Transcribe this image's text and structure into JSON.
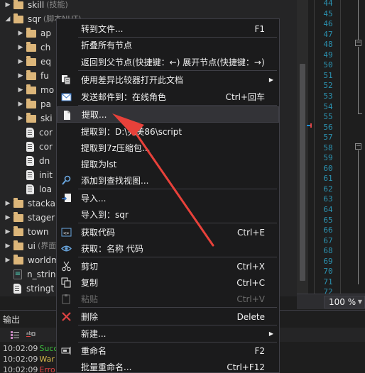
{
  "tree": {
    "items": [
      {
        "label": "skill",
        "sub": "(技能)",
        "kind": "folder",
        "expanded": false
      },
      {
        "label": "sqr",
        "sub": "(脚本NUT)",
        "kind": "folder",
        "expanded": true
      },
      {
        "label": "ap",
        "kind": "folder",
        "expanded": false
      },
      {
        "label": "ch",
        "kind": "folder",
        "expanded": false
      },
      {
        "label": "eq",
        "kind": "folder",
        "expanded": false
      },
      {
        "label": "fu",
        "kind": "folder",
        "expanded": false
      },
      {
        "label": "mo",
        "kind": "folder",
        "expanded": false
      },
      {
        "label": "pa",
        "kind": "folder",
        "expanded": false
      },
      {
        "label": "ski",
        "kind": "folder",
        "expanded": false
      },
      {
        "label": "cor",
        "kind": "script"
      },
      {
        "label": "cor",
        "kind": "script"
      },
      {
        "label": "dn",
        "kind": "script"
      },
      {
        "label": "init",
        "kind": "script"
      },
      {
        "label": "loa",
        "kind": "script"
      },
      {
        "label": "stacka",
        "kind": "folder",
        "expanded": false
      },
      {
        "label": "stager",
        "kind": "folder",
        "expanded": false
      },
      {
        "label": "town",
        "kind": "folder",
        "expanded": false
      },
      {
        "label": "ui",
        "sub": "(界面",
        "kind": "folder",
        "expanded": false
      },
      {
        "label": "worldm",
        "kind": "folder",
        "expanded": false
      },
      {
        "label": "n_strin",
        "kind": "stringtable"
      },
      {
        "label": "stringt",
        "kind": "script"
      }
    ]
  },
  "line_numbers": [
    "44",
    "45",
    "46",
    "47",
    "48",
    "49",
    "50",
    "51",
    "52",
    "53",
    "54",
    "55",
    "56",
    "57",
    "58",
    "59",
    "60",
    "61",
    "62",
    "63",
    "64",
    "65",
    "66",
    "67",
    "68",
    "69",
    "70",
    "71",
    "72"
  ],
  "zoom": {
    "value": "100 %"
  },
  "output": {
    "title": "输出",
    "lines": [
      {
        "time": "10:02:09",
        "text": "Succ",
        "color": "#3fbf3f"
      },
      {
        "time": "10:02:09",
        "text": "War",
        "color": "#d7ba4a"
      },
      {
        "time": "10:02:09",
        "text": "Erro",
        "color": "#e04343"
      }
    ]
  },
  "context_menu": {
    "items": [
      {
        "id": "goto-file",
        "label": "转到文件...",
        "shortcut": "F1",
        "icon": "",
        "submenu": false,
        "disabled": false
      },
      {
        "id": "sep1",
        "separator": true
      },
      {
        "id": "collapse-all",
        "label": "折叠所有节点",
        "shortcut": "",
        "icon": "",
        "submenu": false,
        "disabled": false
      },
      {
        "id": "back-parent",
        "label": "返回到父节点(快捷键：←) 展开节点(快捷键：→)",
        "shortcut": "",
        "icon": "",
        "submenu": false,
        "disabled": false
      },
      {
        "id": "sep2",
        "separator": true
      },
      {
        "id": "diff-open",
        "label": "使用差异比较器打开此文档",
        "shortcut": "",
        "icon": "diff-icon",
        "submenu": true,
        "disabled": false
      },
      {
        "id": "send-mail",
        "label": "发送邮件到：在线角色",
        "shortcut": "Ctrl+回车",
        "icon": "mail-icon",
        "submenu": false,
        "disabled": false
      },
      {
        "id": "sep3",
        "separator": true
      },
      {
        "id": "extract",
        "label": "提取...",
        "shortcut": "",
        "icon": "extract-icon",
        "submenu": false,
        "disabled": false,
        "highlighted": true
      },
      {
        "id": "extract-to",
        "label": "提取到：D:\\完美86\\script",
        "shortcut": "",
        "icon": "",
        "submenu": false,
        "disabled": false
      },
      {
        "id": "extract-7z",
        "label": "提取到7z压缩包...",
        "shortcut": "",
        "icon": "",
        "submenu": false,
        "disabled": false
      },
      {
        "id": "extract-lst",
        "label": "提取为lst",
        "shortcut": "",
        "icon": "",
        "submenu": false,
        "disabled": false
      },
      {
        "id": "add-view",
        "label": "添加到查找视图...",
        "shortcut": "",
        "icon": "find-view-icon",
        "submenu": false,
        "disabled": false
      },
      {
        "id": "sep4",
        "separator": true
      },
      {
        "id": "import",
        "label": "导入...",
        "shortcut": "",
        "icon": "import-icon",
        "submenu": false,
        "disabled": false
      },
      {
        "id": "import-to",
        "label": "导入到：sqr",
        "shortcut": "",
        "icon": "",
        "submenu": false,
        "disabled": false
      },
      {
        "id": "sep5",
        "separator": true
      },
      {
        "id": "get-code",
        "label": "获取代码",
        "shortcut": "Ctrl+E",
        "icon": "code-icon",
        "submenu": false,
        "disabled": false
      },
      {
        "id": "get-name-code",
        "label": "获取：名称 代码",
        "shortcut": "",
        "icon": "eye-icon",
        "submenu": false,
        "disabled": false
      },
      {
        "id": "sep6",
        "separator": true
      },
      {
        "id": "cut",
        "label": "剪切",
        "shortcut": "Ctrl+X",
        "icon": "cut-icon",
        "submenu": false,
        "disabled": false
      },
      {
        "id": "copy",
        "label": "复制",
        "shortcut": "Ctrl+C",
        "icon": "copy-icon",
        "submenu": false,
        "disabled": false
      },
      {
        "id": "paste",
        "label": "粘贴",
        "shortcut": "Ctrl+V",
        "icon": "paste-icon",
        "submenu": false,
        "disabled": true
      },
      {
        "id": "sep7",
        "separator": true
      },
      {
        "id": "delete",
        "label": "删除",
        "shortcut": "Delete",
        "icon": "delete-icon",
        "submenu": false,
        "disabled": false
      },
      {
        "id": "sep8",
        "separator": true
      },
      {
        "id": "new",
        "label": "新建...",
        "shortcut": "",
        "icon": "",
        "submenu": true,
        "disabled": false
      },
      {
        "id": "sep9",
        "separator": true
      },
      {
        "id": "rename",
        "label": "重命名",
        "shortcut": "F2",
        "icon": "rename-icon",
        "submenu": false,
        "disabled": false
      },
      {
        "id": "batch-rename",
        "label": "批量重命名...",
        "shortcut": "Ctrl+F12",
        "icon": "",
        "submenu": false,
        "disabled": false
      }
    ]
  },
  "colors": {
    "accent": "#1f8ad2",
    "annotation_arrow": "#e8413a"
  }
}
